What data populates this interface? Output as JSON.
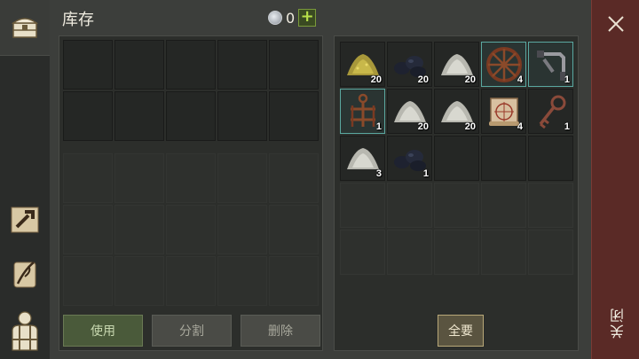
{
  "header": {
    "title": "库存",
    "coin_count": "0",
    "plus_label": "+"
  },
  "storage": {
    "actions": {
      "use": "使用",
      "split": "分割",
      "delete": "删除"
    }
  },
  "bag": {
    "items": [
      {
        "icon": "ore-pile-yellow-icon",
        "qty": "20",
        "highlight": false
      },
      {
        "icon": "coal-pile-icon",
        "qty": "20",
        "highlight": false
      },
      {
        "icon": "powder-pile-white-icon",
        "qty": "20",
        "highlight": false
      },
      {
        "icon": "wagon-wheel-icon",
        "qty": "4",
        "highlight": true
      },
      {
        "icon": "crank-handle-icon",
        "qty": "1",
        "highlight": true
      },
      {
        "icon": "anchor-frame-icon",
        "qty": "1",
        "highlight": true
      },
      {
        "icon": "powder-pile-white-icon",
        "qty": "20",
        "highlight": false
      },
      {
        "icon": "powder-pile-white-icon",
        "qty": "20",
        "highlight": false
      },
      {
        "icon": "map-scroll-icon",
        "qty": "4",
        "highlight": false
      },
      {
        "icon": "ornate-key-icon",
        "qty": "1",
        "highlight": false
      },
      {
        "icon": "powder-pile-white-icon",
        "qty": "3",
        "highlight": false
      },
      {
        "icon": "coal-pile-icon",
        "qty": "1",
        "highlight": false
      }
    ],
    "take_all": "全要"
  },
  "close": {
    "label": "关闭"
  },
  "colors": {
    "close_bg": "#5a2a26",
    "highlight_border": "#5aa8a0",
    "use_button": "#4a5a3a"
  }
}
